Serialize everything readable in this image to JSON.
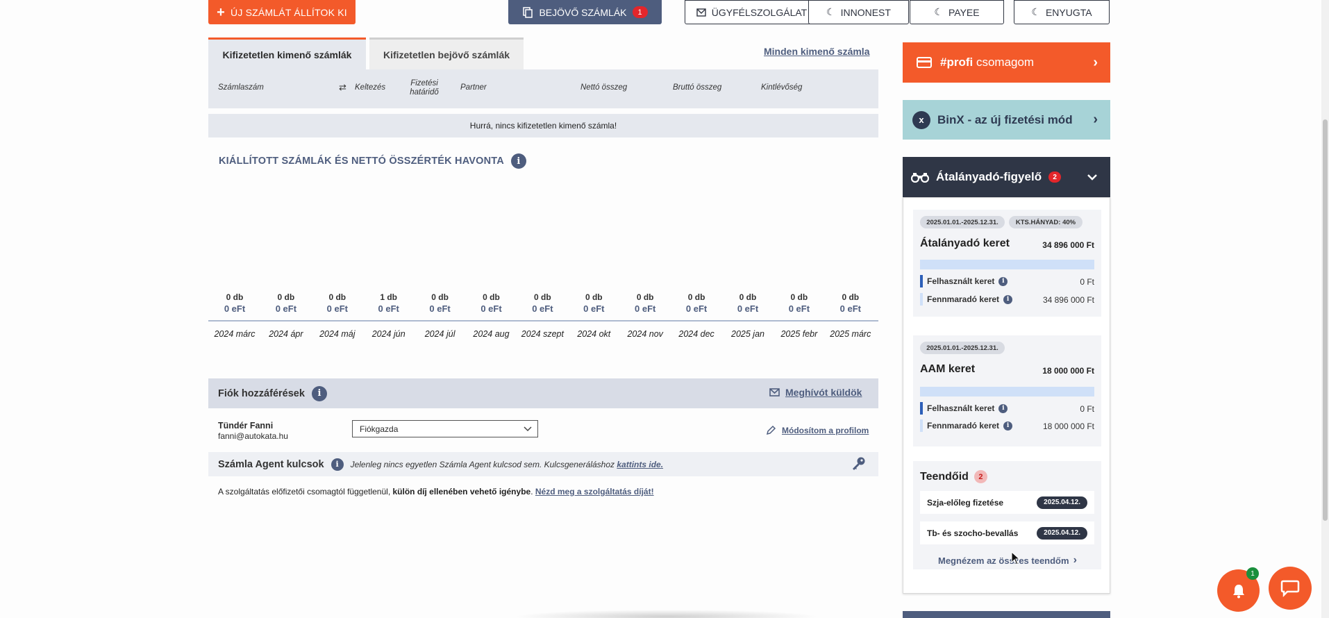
{
  "top_buttons": {
    "new_invoice": "ÚJ SZÁMLÁT ÁLLÍTOK KI",
    "incoming": "BEJÖVŐ SZÁMLÁK",
    "incoming_count": "1",
    "support": "ÜGYFÉLSZOLGÁLAT",
    "innonest": "INNONEST",
    "payee": "PAYEE",
    "enyugta": "ENYUGTA"
  },
  "tabs": {
    "outgoing": "Kifizetetlen kimenő számlák",
    "incoming": "Kifizetetlen bejövő számlák",
    "all_link": "Minden kimenő számla"
  },
  "table": {
    "columns": [
      "Számlaszám",
      "Keltezés",
      "Fizetési határidő",
      "Partner",
      "Nettó összeg",
      "Bruttó összeg",
      "Kintlévőség"
    ],
    "empty_message": "Hurrá, nincs kifizetetlen kimenő számla!"
  },
  "chart_title": "KIÁLLÍTOTT SZÁMLÁK ÉS NETTÓ ÖSSZÉRTÉK HAVONTA",
  "chart_data": {
    "type": "table",
    "categories": [
      "2024 márc",
      "2024 ápr",
      "2024 máj",
      "2024 jún",
      "2024 júl",
      "2024 aug",
      "2024 szept",
      "2024 okt",
      "2024 nov",
      "2024 dec",
      "2025 jan",
      "2025 febr",
      "2025 márc"
    ],
    "series": [
      {
        "values": [
          0,
          0,
          0,
          1,
          0,
          0,
          0,
          0,
          0,
          0,
          0,
          0,
          0
        ]
      },
      {
        "values": [
          0,
          0,
          0,
          0,
          0,
          0,
          0,
          0,
          0,
          0,
          0,
          0,
          0
        ]
      }
    ],
    "count_labels": [
      "0 db",
      "0 db",
      "0 db",
      "1 db",
      "0 db",
      "0 db",
      "0 db",
      "0 db",
      "0 db",
      "0 db",
      "0 db",
      "0 db",
      "0 db"
    ],
    "value_labels": [
      "0 eFt",
      "0 eFt",
      "0 eFt",
      "0 eFt",
      "0 eFt",
      "0 eFt",
      "0 eFt",
      "0 eFt",
      "0 eFt",
      "0 eFt",
      "0 eFt",
      "0 eFt",
      "0 eFt"
    ]
  },
  "access": {
    "title": "Fiók hozzáférések",
    "invite": "Meghívót küldök",
    "user_name": "Tündér Fanni",
    "user_email": "fanni@autokata.hu",
    "role": "Fiókgazda",
    "edit_profile": "Módosítom a profilom"
  },
  "agent": {
    "title": "Számla Agent kulcsok",
    "note": "Jelenleg nincs egyetlen Számla Agent kulcsod sem. Kulcsgeneráláshoz ",
    "note_link": "kattints ide.",
    "service_text": "A szolgáltatás előfizetői csomagtól függetlenül, ",
    "service_bold": "külön díj ellenében vehető igénybe",
    "service_dot": ". ",
    "service_link": "Nézd meg a szolgáltatás díját!"
  },
  "sidebar": {
    "profi_bold": "#profi",
    "profi_rest": " csomagom",
    "binx": "BinX - az új fizetési mód",
    "atal_title": "Átalányadó-figyelő",
    "atal_count": "2",
    "box1": {
      "period": "2025.01.01.-2025.12.31.",
      "ratio": "KTS.HÁNYAD: 40%",
      "title": "Átalányadó keret",
      "amount": "34 896 000 Ft",
      "used_fraction": 0,
      "used_label": "Felhasznált keret",
      "used_value": "0 Ft",
      "remaining_label": "Fennmaradó keret",
      "remaining_value": "34 896 000 Ft"
    },
    "box2": {
      "period": "2025.01.01.-2025.12.31.",
      "title": "AAM keret",
      "amount": "18 000 000 Ft",
      "used_fraction": 0,
      "used_label": "Felhasznált keret",
      "used_value": "0 Ft",
      "remaining_label": "Fennmaradó keret",
      "remaining_value": "18 000 000 Ft"
    },
    "todo": {
      "title": "Teendőid",
      "count": "2",
      "items": [
        {
          "label": "Szja-előleg fizetése",
          "date": "2025.04.12."
        },
        {
          "label": "Tb- és szocho-bevallás",
          "date": "2025.04.12."
        }
      ],
      "all_link": "Megnézem az összes teendőm"
    }
  },
  "notifications": {
    "count": "1"
  },
  "colors": {
    "accent": "#f35a2a",
    "navy": "#4e5d7e",
    "dark": "#2f3646",
    "teal": "#a7d3d7"
  }
}
